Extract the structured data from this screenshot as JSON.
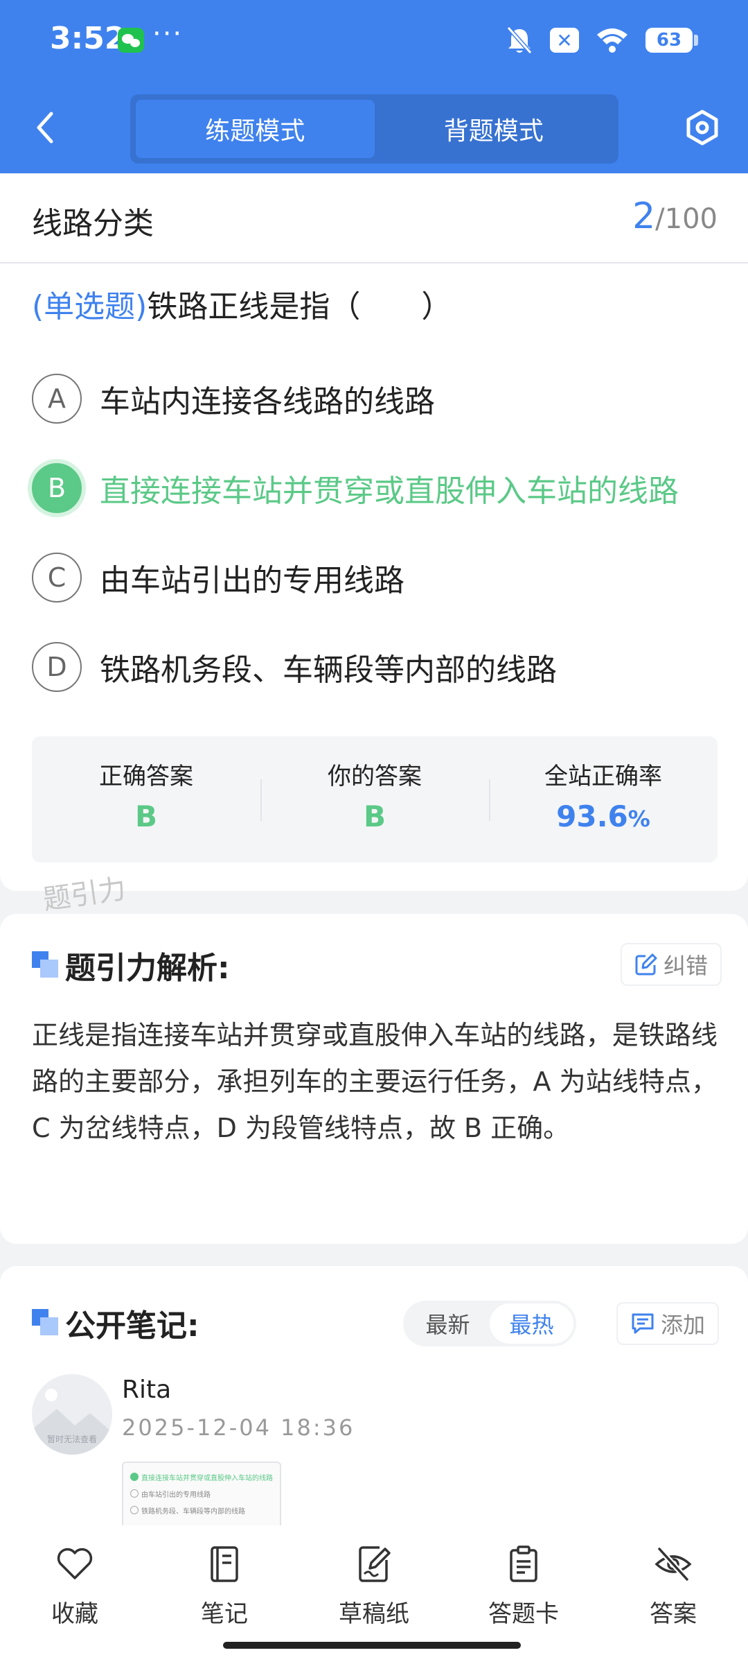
{
  "status_bar": {
    "time": "3:52",
    "more": "···",
    "battery": "63"
  },
  "nav": {
    "tabs": [
      {
        "label": "练题模式",
        "active": true
      },
      {
        "label": "背题模式",
        "active": false
      }
    ]
  },
  "question": {
    "category": "线路分类",
    "progress_current": "2",
    "progress_total": "/100",
    "type_label": "(单选题)",
    "stem": "铁路正线是指（　　）",
    "options": [
      {
        "letter": "A",
        "text": "车站内连接各线路的线路",
        "correct": false
      },
      {
        "letter": "B",
        "text": "直接连接车站并贯穿或直股伸入车站的线路",
        "correct": true
      },
      {
        "letter": "C",
        "text": "由车站引出的专用线路",
        "correct": false
      },
      {
        "letter": "D",
        "text": "铁路机务段、车辆段等内部的线路",
        "correct": false
      }
    ],
    "stats": {
      "correct_label": "正确答案",
      "correct_value": "B",
      "your_label": "你的答案",
      "your_value": "B",
      "rate_label": "全站正确率",
      "rate_value": "93.6",
      "rate_unit": "%"
    },
    "watermark": "题引力"
  },
  "analysis": {
    "title": "题引力解析:",
    "report_label": "纠错",
    "text": "正线是指连接车站并贯穿或直股伸入车站的线路，是铁路线路的主要部分，承担列车的主要运行任务，A 为站线特点，C 为岔线特点，D 为段管线特点，故 B 正确。"
  },
  "notes": {
    "title": "公开笔记:",
    "sort_options": [
      {
        "label": "最新",
        "active": false
      },
      {
        "label": "最热",
        "active": true
      }
    ],
    "add_label": "添加",
    "entry": {
      "author": "Rita",
      "time": "2025-12-04 18:36",
      "avatar_caption": "暂时无法查看",
      "image_lines": [
        "直接连接车站并贯穿或直股伸入车站的线路",
        "由车站引出的专用线路",
        "铁路机务段、车辆段等内部的线路"
      ]
    }
  },
  "bottom_bar": [
    {
      "label": "收藏",
      "icon": "heart-icon"
    },
    {
      "label": "笔记",
      "icon": "notebook-icon"
    },
    {
      "label": "草稿纸",
      "icon": "draft-paper-icon"
    },
    {
      "label": "答题卡",
      "icon": "answer-card-icon"
    },
    {
      "label": "答案",
      "icon": "eye-off-icon"
    }
  ],
  "colors": {
    "primary": "#3f82ee",
    "correct": "#5bc987"
  }
}
